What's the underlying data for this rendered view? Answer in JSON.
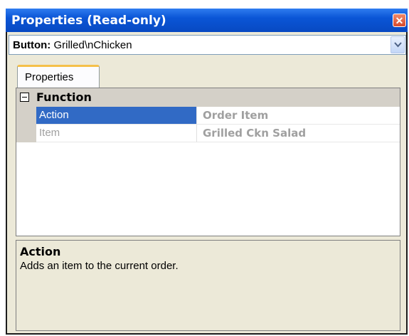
{
  "window": {
    "title": "Properties (Read-only)",
    "close_label": "✕"
  },
  "selector": {
    "type_label": "Button:",
    "value": "Grilled\\nChicken"
  },
  "tabs": [
    {
      "label": "Properties"
    }
  ],
  "grid": {
    "category": {
      "label": "Function",
      "toggle": "collapse-icon"
    },
    "rows": [
      {
        "name": "Action",
        "value": "Order Item",
        "selected": true
      },
      {
        "name": "Item",
        "value": "Grilled Ckn Salad",
        "selected": false
      }
    ]
  },
  "help": {
    "title": "Action",
    "description": "Adds an item to the current order."
  },
  "colors": {
    "titlebar": "#0a55d6",
    "selection": "#316ac5",
    "tab_accent": "#f5c04a",
    "close_button": "#d84a2c"
  }
}
